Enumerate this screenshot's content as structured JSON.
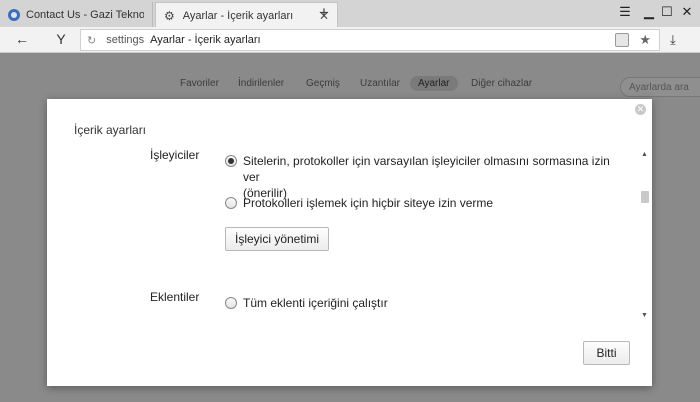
{
  "tabs": [
    {
      "title": "Contact Us - Gazi Teknoparl",
      "icon": "site-favicon-icon"
    },
    {
      "title": "Ayarlar - İçerik ayarları",
      "icon": "gear-icon"
    }
  ],
  "toolbar": {
    "url_scheme": "settings",
    "url_path": "Ayarlar - İçerik ayarları"
  },
  "settings_nav": {
    "items": [
      "Favoriler",
      "İndirilenler",
      "Geçmiş",
      "Uzantılar",
      "Ayarlar",
      "Diğer cihazlar"
    ],
    "active": "Ayarlar",
    "search_placeholder": "Ayarlarda ara"
  },
  "dialog": {
    "title": "İçerik ayarları",
    "handlers": {
      "label": "İşleyiciler",
      "option_allow_line1": "Sitelerin, protokoller için varsayılan işleyiciler olmasını sormasına izin ver",
      "option_allow_line2": "(önerilir)",
      "option_deny": "Protokolleri işlemek için hiçbir siteye izin verme",
      "manage_button": "İşleyici yönetimi",
      "selected": "allow"
    },
    "plugins": {
      "label": "Eklentiler",
      "option_run_all": "Tüm eklenti içeriğini çalıştır"
    },
    "done_button": "Bitti"
  }
}
